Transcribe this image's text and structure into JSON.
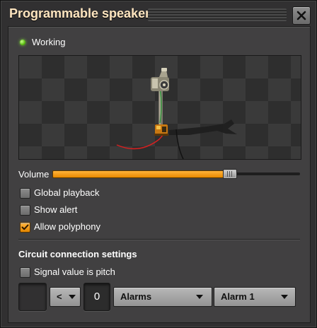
{
  "window": {
    "title": "Programmable speaker",
    "close_icon": "close-icon"
  },
  "status": {
    "text": "Working",
    "indicator_color": "#5bbd12"
  },
  "preview": {
    "entity": "programmable-speaker",
    "icon": "speaker-entity-icon"
  },
  "volume": {
    "label": "Volume",
    "level": 0.7,
    "fill_color": "#f2a11a"
  },
  "options": [
    {
      "label": "Global playback",
      "checked": false
    },
    {
      "label": "Show alert",
      "checked": false
    },
    {
      "label": "Allow polyphony",
      "checked": true
    }
  ],
  "circuit": {
    "section_title": "Circuit connection settings",
    "signal_is_pitch": {
      "label": "Signal value is pitch",
      "checked": false
    },
    "comparator": "<",
    "constant": "0",
    "instrument": "Alarms",
    "note": "Alarm 1"
  },
  "colors": {
    "accent": "#f2a11a",
    "title": "#ffe6c0",
    "panel": "#414041",
    "frame": "#313031"
  }
}
